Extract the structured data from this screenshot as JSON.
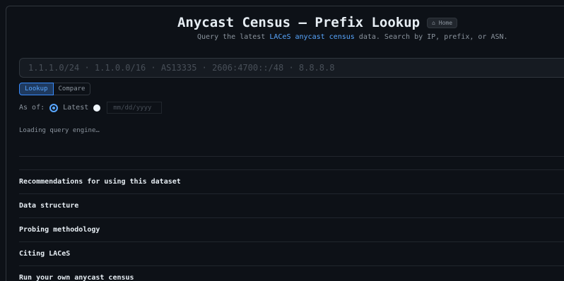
{
  "header": {
    "title": "Anycast Census — Prefix Lookup",
    "home_label": "⌂ Home",
    "subtitle_pre": "Query the latest ",
    "subtitle_link": "LACeS anycast census",
    "subtitle_post": " data. Search by IP, prefix, or ASN."
  },
  "search": {
    "placeholder": "1.1.1.0/24 · 1.1.0.0/16 · AS13335 · 2606:4700::/48 · 8.8.8.8",
    "value": ""
  },
  "tabs": [
    {
      "label": "Lookup",
      "active": true
    },
    {
      "label": "Compare",
      "active": false
    }
  ],
  "asof": {
    "label": "As of:",
    "latest_label": "Latest",
    "date_placeholder": "mm/dd/yyyy",
    "selected": "Latest"
  },
  "status": {
    "text": "Loading query engine…"
  },
  "sections": [
    {
      "label": "Recommendations for using this dataset"
    },
    {
      "label": "Data structure"
    },
    {
      "label": "Probing methodology"
    },
    {
      "label": "Citing LACeS"
    },
    {
      "label": "Run your own anycast census"
    }
  ],
  "colors": {
    "accent": "#58a6ff",
    "background": "#0d1117",
    "border": "#30363d"
  }
}
